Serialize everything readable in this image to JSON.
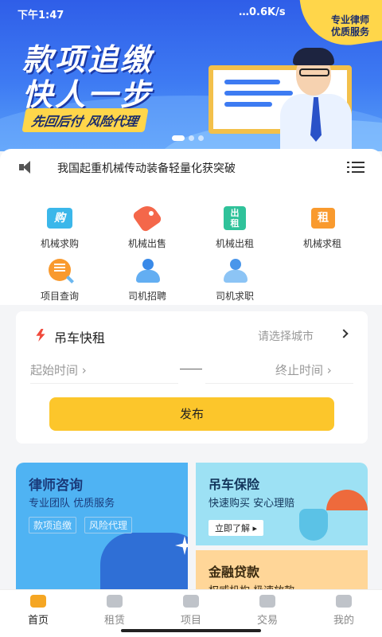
{
  "status_bar": {
    "time": "下午1:47",
    "network": "…0.6K/s"
  },
  "banner": {
    "headline_line1": "款项追缴",
    "headline_line2": "快人一步",
    "tagline": "先回后付 风险代理",
    "corner_tag_line1": "专业律师",
    "corner_tag_line2": "优质服务",
    "carousel_dots": 3,
    "active_dot": 0,
    "colors": {
      "primary": "#3e7bf3",
      "accent": "#ffd64a"
    }
  },
  "notice": {
    "text": "我国起重机械传动装备轻量化获突破"
  },
  "categories": [
    {
      "label": "机械求购",
      "icon": "buy-tag-icon"
    },
    {
      "label": "机械出售",
      "icon": "sale-tag-icon"
    },
    {
      "label": "机械出租",
      "icon": "rent-out-icon"
    },
    {
      "label": "机械求租",
      "icon": "rent-request-icon"
    },
    {
      "label": "项目查询",
      "icon": "project-search-icon"
    },
    {
      "label": "司机招聘",
      "icon": "driver-recruit-icon"
    },
    {
      "label": "司机求职",
      "icon": "driver-jobseek-icon"
    }
  ],
  "rental": {
    "title": "吊车快租",
    "city_placeholder": "请选择城市",
    "start_label": "起始时间",
    "end_label": "终止时间",
    "submit_label": "发布",
    "submit_color": "#fcc62b"
  },
  "promos": {
    "lawyer": {
      "title": "律师咨询",
      "subtitle": "专业团队 优质服务",
      "chips": [
        "款项追缴",
        "风险代理"
      ]
    },
    "insurance": {
      "title": "吊车保险",
      "subtitle": "快速购买 安心理赔",
      "button": "立即了解 ▸"
    },
    "loan": {
      "title": "金融贷款",
      "subtitle": "权威机构 极速放款"
    }
  },
  "tabbar": {
    "active": 0,
    "tabs": [
      {
        "label": "首页",
        "icon": "home-icon"
      },
      {
        "label": "租赁",
        "icon": "lease-icon"
      },
      {
        "label": "项目",
        "icon": "project-icon"
      },
      {
        "label": "交易",
        "icon": "trade-icon"
      },
      {
        "label": "我的",
        "icon": "profile-icon"
      }
    ]
  }
}
